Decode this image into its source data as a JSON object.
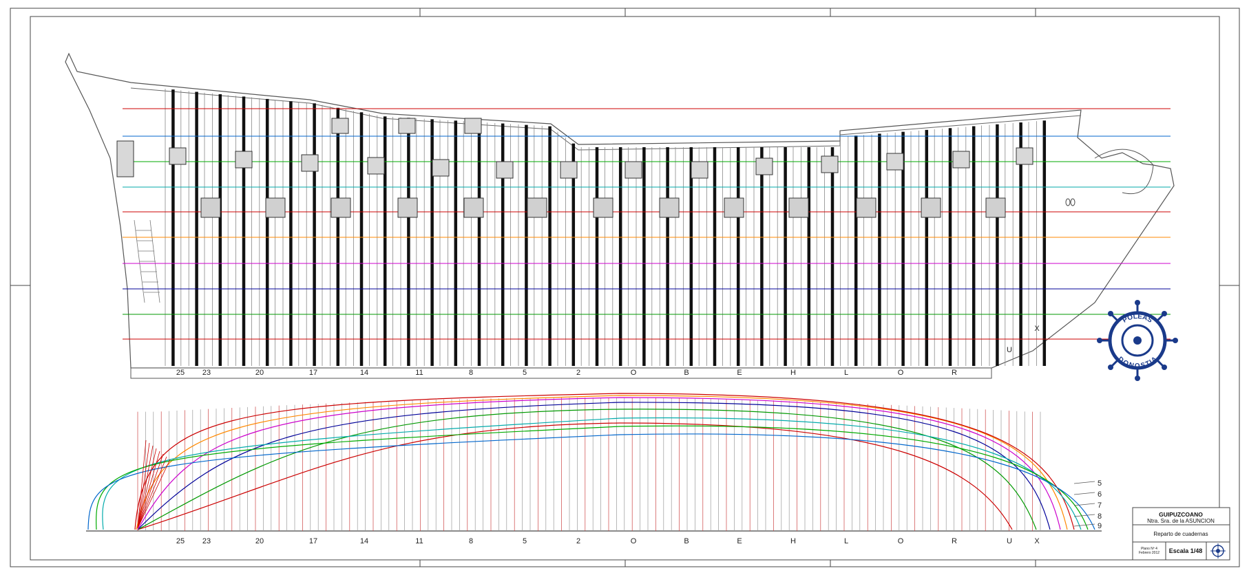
{
  "plan": {
    "title_block": {
      "line1": "GUIPUZCOANO",
      "line2": "Ntra. Sra. de la ASUNCION",
      "subject": "Reparto de cuadernas",
      "sheet_line1": "Plano Nº 4",
      "sheet_line2": "Febrero 2012",
      "scale": "Escala 1/48"
    },
    "logo": {
      "top_text": "POLEAS",
      "bottom_text": "DONOSTIA"
    },
    "frame_labels": [
      "25",
      "23",
      "20",
      "17",
      "14",
      "11",
      "8",
      "5",
      "2",
      "O",
      "B",
      "E",
      "H",
      "L",
      "O",
      "R",
      "U",
      "X"
    ],
    "waterline_numbers": [
      "5",
      "6",
      "7",
      "8",
      "9"
    ],
    "waterline_colors": [
      "#cc0000",
      "#0066cc",
      "#00aa00",
      "#00aaaa",
      "#cc0000",
      "#ff8800",
      "#cc00cc",
      "#000099",
      "#009900",
      "#cc0000"
    ]
  }
}
